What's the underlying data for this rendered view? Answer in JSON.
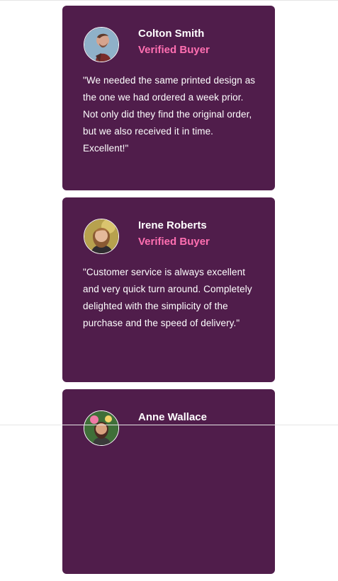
{
  "testimonials": [
    {
      "name": "Colton Smith",
      "role": "Verified Buyer",
      "quote": "\"We needed the same printed design as the one we had ordered a week prior. Not only did they find the original order, but we also received it in time. Excellent!\""
    },
    {
      "name": "Irene Roberts",
      "role": "Verified Buyer",
      "quote": "\"Customer service is always excellent and very quick turn around. Completely delighted with the simplicity of the purchase and the speed of delivery.\""
    },
    {
      "name": "Anne Wallace",
      "role": "",
      "quote": ""
    }
  ],
  "colors": {
    "card_background": "#501d4b",
    "accent": "#ff6fb1",
    "text": "#ffffff"
  }
}
